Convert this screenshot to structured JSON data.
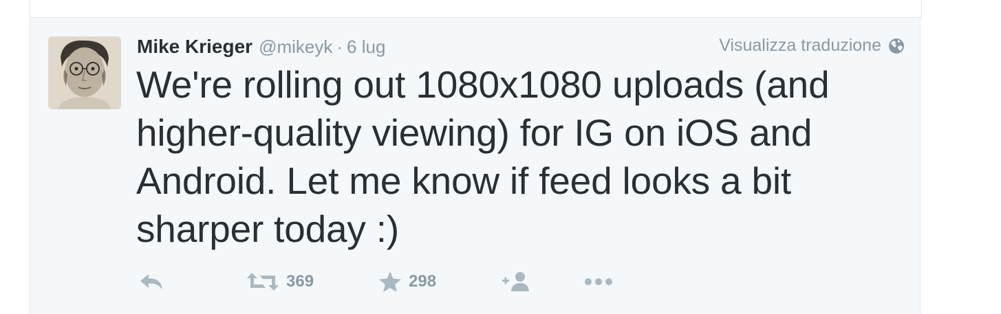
{
  "tweet": {
    "fullname": "Mike Krieger",
    "screen_name": "@mikeyk",
    "separator": "·",
    "timestamp": "6 lug",
    "translate_label": "Visualizza traduzione",
    "text": "We're rolling out 1080x1080 uploads (and higher-quality viewing) for IG on iOS and Android. Let me know if feed looks a bit sharper today :)",
    "retweet_count": "369",
    "favorite_count": "298"
  },
  "icons": {
    "avatar": "profile-photo",
    "translate": "globe-icon",
    "reply": "reply-icon",
    "retweet": "retweet-icon",
    "favorite": "star-icon",
    "follow": "add-user-icon",
    "more": "more-dots-icon"
  },
  "colors": {
    "text": "#292f33",
    "muted": "#8899a6",
    "icon": "#aab8c2",
    "tweet_bg": "#f5f8fa",
    "border": "#e1e8ed"
  }
}
